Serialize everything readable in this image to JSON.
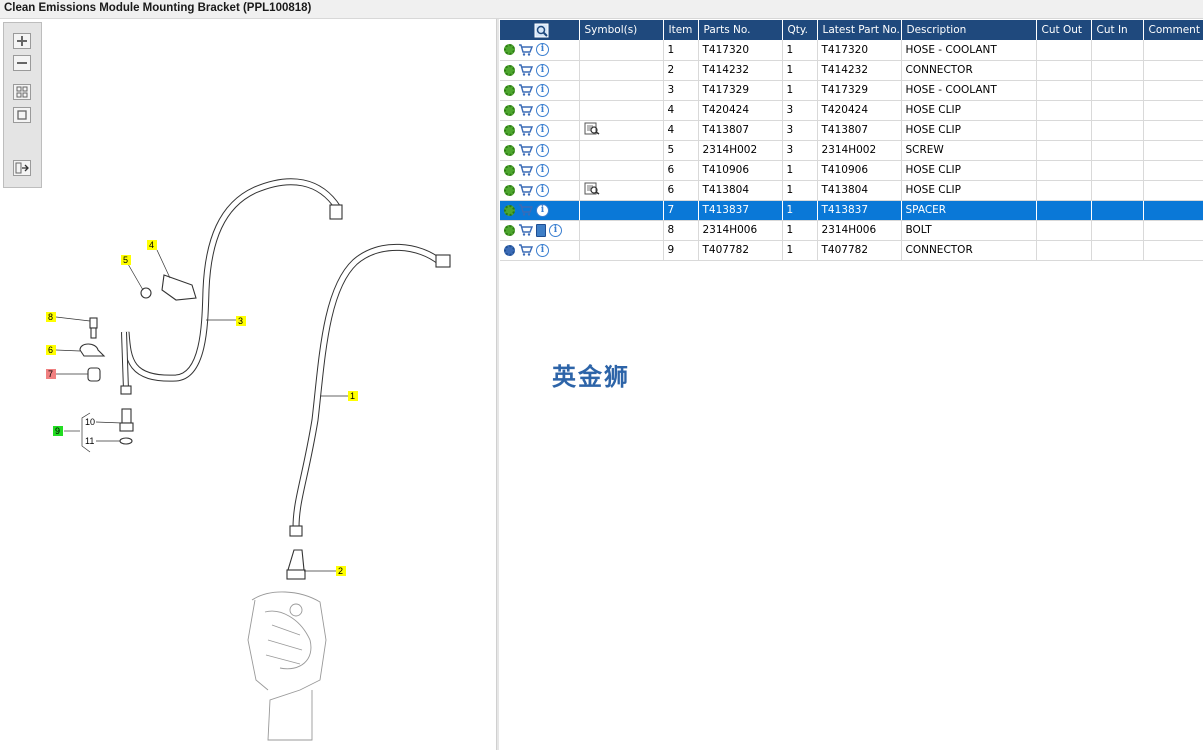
{
  "window": {
    "title": "Clean Emissions Module Mounting Bracket (PPL100818)"
  },
  "toolbar": {
    "zoom_in": "zoom-in-icon",
    "zoom_out": "zoom-out-icon",
    "fit_all": "fit-all-icon",
    "fit_window": "fit-window-icon",
    "export": "export-icon"
  },
  "diagram": {
    "callouts": [
      {
        "label": "4",
        "color": "#ffff00"
      },
      {
        "label": "5",
        "color": "#ffff00"
      },
      {
        "label": "3",
        "color": "#ffff00"
      },
      {
        "label": "8",
        "color": "#ffff00"
      },
      {
        "label": "6",
        "color": "#ffff00"
      },
      {
        "label": "7",
        "color": "#f08080"
      },
      {
        "label": "9",
        "color": "#22dd22"
      },
      {
        "label": "10",
        "color": ""
      },
      {
        "label": "11",
        "color": ""
      },
      {
        "label": "1",
        "color": "#ffff00"
      },
      {
        "label": "2",
        "color": "#ffff00"
      }
    ]
  },
  "table": {
    "headers": [
      "",
      "Symbol(s)",
      "Item",
      "Parts No.",
      "Qty.",
      "Latest Part No.",
      "Description",
      "Cut Out",
      "Cut In",
      "Comment"
    ],
    "rows": [
      {
        "item": "1",
        "part": "T417320",
        "qty": "1",
        "latest": "T417320",
        "desc": "HOSE - COOLANT",
        "symbol": false,
        "selected": false,
        "book": false,
        "gear_color": "green"
      },
      {
        "item": "2",
        "part": "T414232",
        "qty": "1",
        "latest": "T414232",
        "desc": "CONNECTOR",
        "symbol": false,
        "selected": false,
        "book": false,
        "gear_color": "green"
      },
      {
        "item": "3",
        "part": "T417329",
        "qty": "1",
        "latest": "T417329",
        "desc": "HOSE - COOLANT",
        "symbol": false,
        "selected": false,
        "book": false,
        "gear_color": "green"
      },
      {
        "item": "4",
        "part": "T420424",
        "qty": "3",
        "latest": "T420424",
        "desc": "HOSE CLIP",
        "symbol": false,
        "selected": false,
        "book": false,
        "gear_color": "green"
      },
      {
        "item": "4",
        "part": "T413807",
        "qty": "3",
        "latest": "T413807",
        "desc": "HOSE CLIP",
        "symbol": true,
        "selected": false,
        "book": false,
        "gear_color": "green"
      },
      {
        "item": "5",
        "part": "2314H002",
        "qty": "3",
        "latest": "2314H002",
        "desc": "SCREW",
        "symbol": false,
        "selected": false,
        "book": false,
        "gear_color": "green"
      },
      {
        "item": "6",
        "part": "T410906",
        "qty": "1",
        "latest": "T410906",
        "desc": "HOSE CLIP",
        "symbol": false,
        "selected": false,
        "book": false,
        "gear_color": "green"
      },
      {
        "item": "6",
        "part": "T413804",
        "qty": "1",
        "latest": "T413804",
        "desc": "HOSE CLIP",
        "symbol": true,
        "selected": false,
        "book": false,
        "gear_color": "green"
      },
      {
        "item": "7",
        "part": "T413837",
        "qty": "1",
        "latest": "T413837",
        "desc": "SPACER",
        "symbol": false,
        "selected": true,
        "book": false,
        "gear_color": "green"
      },
      {
        "item": "8",
        "part": "2314H006",
        "qty": "1",
        "latest": "2314H006",
        "desc": "BOLT",
        "symbol": false,
        "selected": false,
        "book": true,
        "gear_color": "green"
      },
      {
        "item": "9",
        "part": "T407782",
        "qty": "1",
        "latest": "T407782",
        "desc": "CONNECTOR",
        "symbol": false,
        "selected": false,
        "book": false,
        "gear_color": "blue"
      }
    ]
  },
  "watermark": "英金狮"
}
